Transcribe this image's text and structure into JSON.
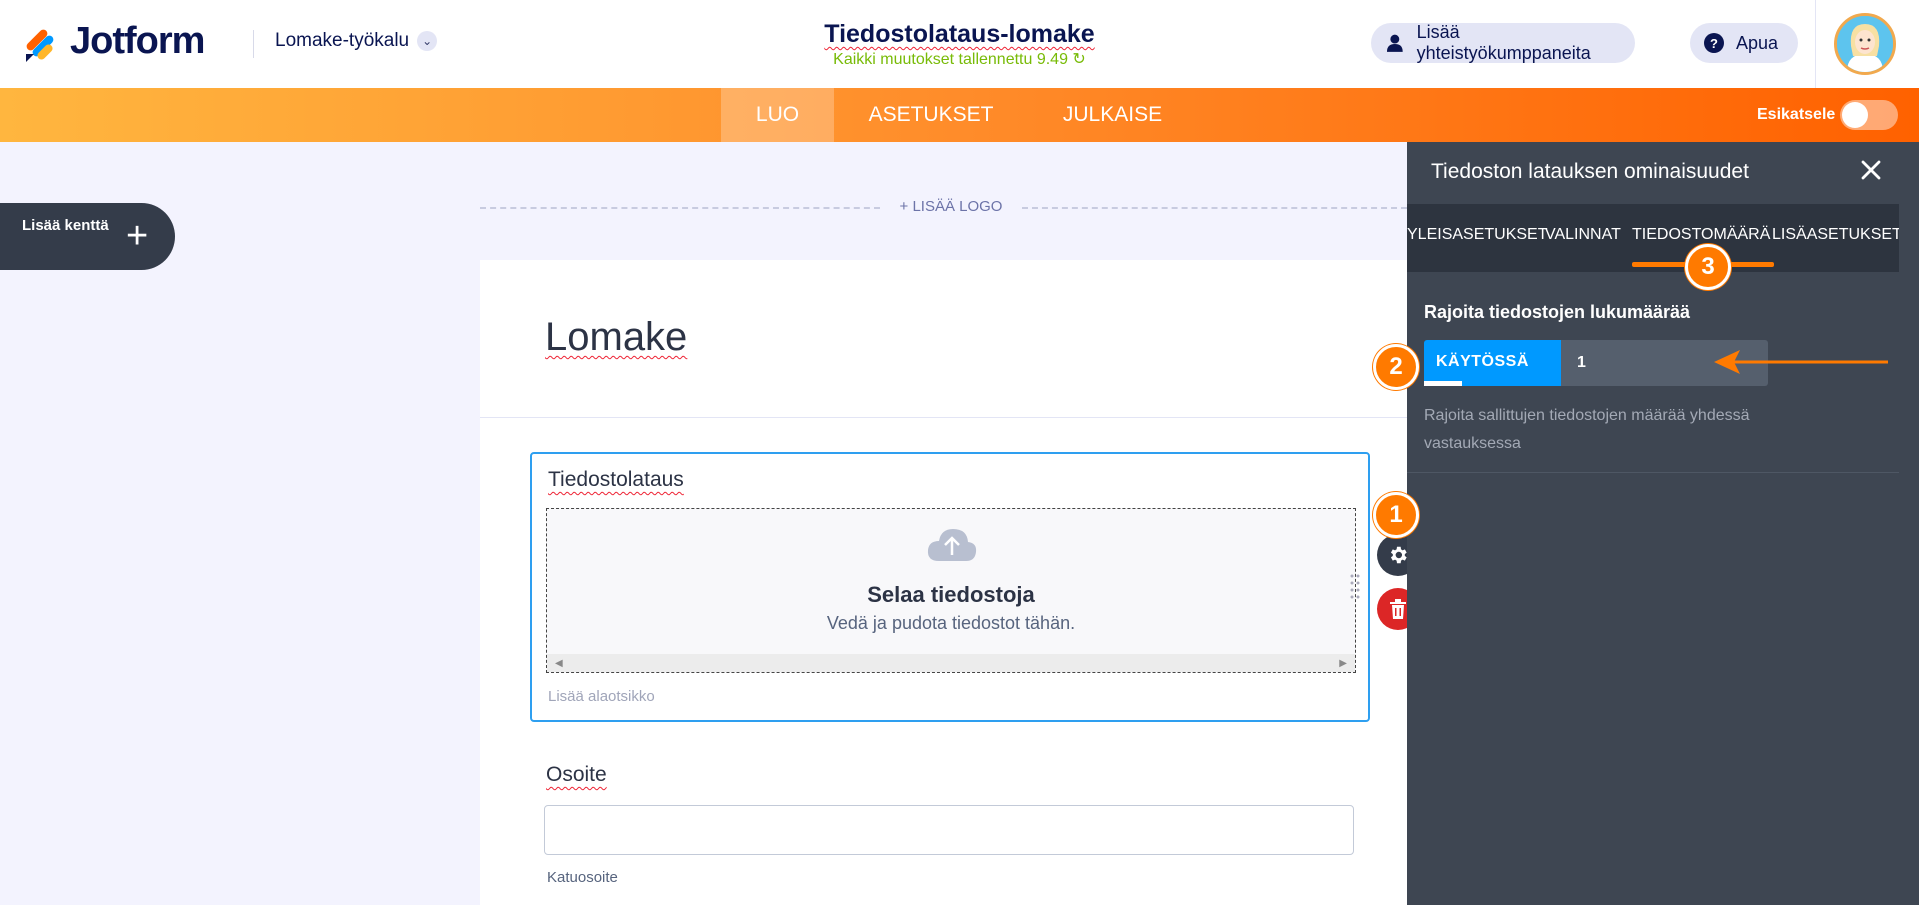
{
  "header": {
    "brand": "Jotform",
    "tool_selector": "Lomake-työkalu",
    "form_title": "Tiedostolataus-lomake",
    "save_status": "Kaikki muutokset tallennettu 9.49",
    "collab_button": "Lisää yhteistyökumppaneita",
    "help_button": "Apua",
    "help_icon_char": "?"
  },
  "nav": {
    "tabs": [
      {
        "label": "LUO"
      },
      {
        "label": "ASETUKSET"
      },
      {
        "label": "JULKAISE"
      }
    ],
    "preview_label": "Esikatsele"
  },
  "builder": {
    "add_field_label": "Lisää kenttä",
    "add_field_plus": "+",
    "add_logo": "+ LISÄÄ LOGO",
    "form_heading": "Lomake",
    "upload_field": {
      "label": "Tiedostolataus",
      "browse_title": "Selaa tiedostoja",
      "drop_hint": "Vedä ja pudota tiedostot tähän.",
      "sublabel_placeholder": "Lisää alaotsikko"
    },
    "address_field": {
      "label": "Osoite",
      "street_sublabel": "Katuosoite"
    }
  },
  "badges": {
    "one": "1",
    "two": "2",
    "three": "3"
  },
  "panel": {
    "title": "Tiedoston latauksen ominaisuudet",
    "tabs": [
      "YLEISASETUKSET",
      "VALINNAT",
      "TIEDOSTOMÄÄRÄ",
      "LISÄASETUKSET"
    ],
    "limit_label": "Rajoita tiedostojen lukumäärää",
    "toggle_label": "KÄYTÖSSÄ",
    "limit_value": "1",
    "limit_description": "Rajoita sallittujen tiedostojen määrää yhdessä vastauksessa"
  },
  "colors": {
    "accent_orange": "#ff7a00",
    "toggle_blue": "#0099ff",
    "panel_bg": "#3e4652",
    "save_green": "#78bb07"
  }
}
